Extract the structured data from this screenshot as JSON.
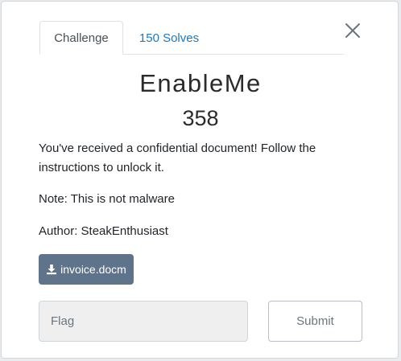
{
  "tabs": [
    {
      "label": "Challenge",
      "active": true
    },
    {
      "label": "150 Solves",
      "active": false
    }
  ],
  "challenge": {
    "name": "EnableMe",
    "points": "358",
    "description": "You've received a confidential document! Follow the instructions to unlock it.",
    "note": "Note: This is not malware",
    "author": "Author: SteakEnthusiast"
  },
  "file": {
    "label": "invoice.docm",
    "icon": "download-icon"
  },
  "flag": {
    "placeholder": "Flag",
    "value": ""
  },
  "submit_label": "Submit",
  "icons": {
    "close": "close-icon"
  },
  "colors": {
    "tab_link": "#1f78c1",
    "file_button": "#5f738a",
    "input_bg": "#efefef"
  }
}
